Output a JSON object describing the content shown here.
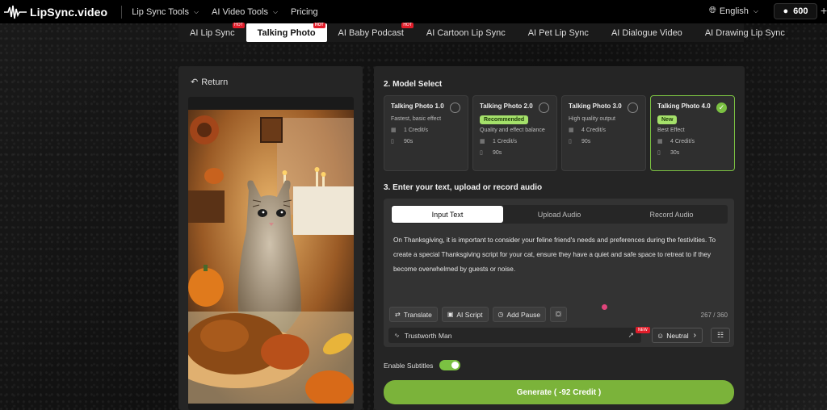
{
  "header": {
    "brand": "LipSync.video",
    "nav": [
      {
        "label": "Lip Sync Tools",
        "has_dropdown": true
      },
      {
        "label": "AI Video Tools",
        "has_dropdown": true
      },
      {
        "label": "Pricing",
        "has_dropdown": false
      }
    ],
    "language": "English",
    "credits": "600",
    "plus": "+"
  },
  "tabs": [
    {
      "label": "AI Lip Sync",
      "hot": true
    },
    {
      "label": "Talking Photo",
      "hot": true,
      "active": true
    },
    {
      "label": "AI Baby Podcast",
      "hot": true
    },
    {
      "label": "AI Cartoon Lip Sync",
      "hot": false
    },
    {
      "label": "AI Pet Lip Sync",
      "hot": false
    },
    {
      "label": "AI Dialogue Video",
      "hot": false
    },
    {
      "label": "AI Drawing Lip Sync",
      "hot": false
    }
  ],
  "left": {
    "return_label": "Return"
  },
  "model_select": {
    "title": "2. Model Select",
    "models": [
      {
        "name": "Talking Photo 1.0",
        "badge": "",
        "desc": "Fastest, basic effect",
        "credit": "1 Credit/s",
        "duration": "90s",
        "selected": false
      },
      {
        "name": "Talking Photo 2.0",
        "badge": "Recommended",
        "desc": "Quality and effect balance",
        "credit": "1 Credit/s",
        "duration": "90s",
        "selected": false
      },
      {
        "name": "Talking Photo 3.0",
        "badge": "",
        "desc": "High quality output",
        "credit": "4 Credit/s",
        "duration": "90s",
        "selected": false
      },
      {
        "name": "Talking Photo 4.0",
        "badge": "New",
        "desc": "Best Effect",
        "credit": "4 Credit/s",
        "duration": "30s",
        "selected": true
      }
    ]
  },
  "input_section": {
    "title": "3. Enter your text, upload or record audio",
    "modes": [
      "Input Text",
      "Upload Audio",
      "Record Audio"
    ],
    "active_mode": "Input Text",
    "text": "On Thanksgiving, it is important to consider your feline friend's needs and preferences during the festivities. To create a special Thanksgiving script for your cat, ensure they have a quiet and safe space to retreat to if they become overwhelmed by guests or noise.",
    "tools": [
      "Translate",
      "AI Script",
      "Add Pause"
    ],
    "char_count": "267 / 360",
    "voice": "Trustworth Man",
    "voice_new_tag": "NEW",
    "emotion": "Neutral"
  },
  "subtitles_label": "Enable Subtitles",
  "subtitles_enabled": true,
  "generate_label": "Generate ( -92 Credit )",
  "colors": {
    "accent": "#7bc142",
    "hot": "#e11d2a",
    "generate": "#7bb33a"
  }
}
